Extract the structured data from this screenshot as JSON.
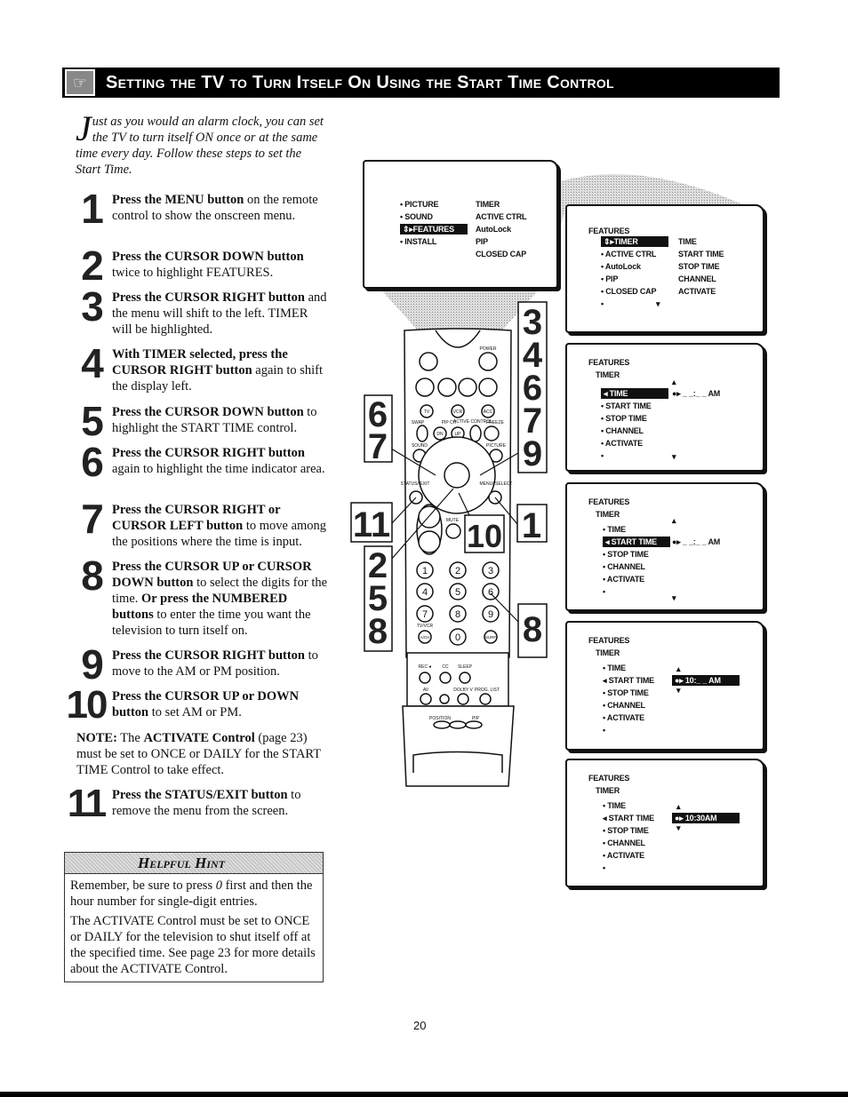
{
  "header": {
    "title": "Setting the TV to Turn Itself On Using the Start Time Control",
    "icon": "remote-hand-icon"
  },
  "intro": {
    "dropcap": "J",
    "text": "ust as you would an alarm clock, you can set the TV to turn itself ON once or at the same time every day. Follow these steps to set the Start Time."
  },
  "steps": [
    {
      "num": "1",
      "parts": [
        {
          "b": true,
          "t": "Press the MENU button"
        },
        {
          "b": false,
          "t": " on the remote control to show the onscreen menu."
        }
      ]
    },
    {
      "num": "2",
      "parts": [
        {
          "b": true,
          "t": "Press the CURSOR DOWN button"
        },
        {
          "b": false,
          "t": " twice to highlight FEATURES."
        }
      ]
    },
    {
      "num": "3",
      "parts": [
        {
          "b": true,
          "t": "Press the CURSOR RIGHT button"
        },
        {
          "b": false,
          "t": " and the menu will shift to the left. TIMER will be highlighted."
        }
      ]
    },
    {
      "num": "4",
      "parts": [
        {
          "b": true,
          "t": "With TIMER selected, press the CURSOR RIGHT button"
        },
        {
          "b": false,
          "t": " again to shift the display left."
        }
      ]
    },
    {
      "num": "5",
      "parts": [
        {
          "b": true,
          "t": "Press the CURSOR DOWN button"
        },
        {
          "b": false,
          "t": " to highlight the START TIME control."
        }
      ]
    },
    {
      "num": "6",
      "parts": [
        {
          "b": true,
          "t": "Press the CURSOR RIGHT button"
        },
        {
          "b": false,
          "t": " again to highlight the time indicator area."
        }
      ]
    },
    {
      "num": "7",
      "parts": [
        {
          "b": true,
          "t": "Press the CURSOR RIGHT or CURSOR LEFT button"
        },
        {
          "b": false,
          "t": " to move among the positions where the time is input."
        }
      ]
    },
    {
      "num": "8",
      "parts": [
        {
          "b": true,
          "t": "Press the CURSOR UP or CURSOR DOWN button"
        },
        {
          "b": false,
          "t": " to select the digits for the time. "
        },
        {
          "b": true,
          "t": "Or press the NUMBERED buttons"
        },
        {
          "b": false,
          "t": " to enter the time you want the television to turn itself on."
        }
      ]
    },
    {
      "num": "9",
      "parts": [
        {
          "b": true,
          "t": "Press the CURSOR RIGHT button"
        },
        {
          "b": false,
          "t": " to move to the AM or PM  position."
        }
      ]
    },
    {
      "num": "10",
      "parts": [
        {
          "b": true,
          "t": "Press the CURSOR UP or DOWN button"
        },
        {
          "b": false,
          "t": " to set AM or PM."
        }
      ]
    },
    {
      "num": "11",
      "parts": [
        {
          "b": true,
          "t": "Press the STATUS/EXIT button"
        },
        {
          "b": false,
          "t": " to remove the menu from the screen."
        }
      ]
    }
  ],
  "note": {
    "parts": [
      {
        "b": true,
        "t": "NOTE:"
      },
      {
        "b": false,
        "t": " The "
      },
      {
        "b": true,
        "t": "ACTIVATE Control"
      },
      {
        "b": false,
        "t": " (page 23) must be set to ONCE or DAILY for the START TIME Control to take effect."
      }
    ]
  },
  "hint": {
    "title": "Helpful Hint",
    "p1_a": "Remember, be sure to press ",
    "p1_zero": "0",
    "p1_b": " first and then the hour number for single-digit entries.",
    "p2": "The ACTIVATE Control must be set to ONCE or DAILY for the television to shut itself off at the specified time. See page 23 for more details about the ACTIVATE Control."
  },
  "page_number": "20",
  "screens": [
    {
      "rows": [
        {
          "t": "• PICTURE",
          "c": 0,
          "r": 0
        },
        {
          "t": "• SOUND",
          "c": 0,
          "r": 1
        },
        {
          "t": "⇕▸FEATURES",
          "c": 0,
          "r": 2,
          "hl": true
        },
        {
          "t": "• INSTALL",
          "c": 0,
          "r": 3
        },
        {
          "t": "TIMER",
          "c": 1,
          "r": 0
        },
        {
          "t": "ACTIVE CTRL",
          "c": 1,
          "r": 1
        },
        {
          "t": "AutoLock",
          "c": 1,
          "r": 2
        },
        {
          "t": "PIP",
          "c": 1,
          "r": 3
        },
        {
          "t": "CLOSED CAP",
          "c": 1,
          "r": 4
        }
      ]
    },
    {
      "rows": [
        {
          "t": "FEATURES",
          "c": -1,
          "r": 0
        },
        {
          "t": "⇕▸TIMER",
          "c": 0,
          "r": 2,
          "hl": true
        },
        {
          "t": "• ACTIVE CTRL",
          "c": 0,
          "r": 3
        },
        {
          "t": "• AutoLock",
          "c": 0,
          "r": 4
        },
        {
          "t": "• PIP",
          "c": 0,
          "r": 5
        },
        {
          "t": "• CLOSED CAP",
          "c": 0,
          "r": 6
        },
        {
          "t": "•",
          "c": 0,
          "r": 7
        },
        {
          "t": "▾",
          "c": 2,
          "r": 7
        },
        {
          "t": "TIME",
          "c": 1,
          "r": 2
        },
        {
          "t": "START TIME",
          "c": 1,
          "r": 3
        },
        {
          "t": "STOP TIME",
          "c": 1,
          "r": 4
        },
        {
          "t": "CHANNEL",
          "c": 1,
          "r": 5
        },
        {
          "t": "ACTIVATE",
          "c": 1,
          "r": 6
        }
      ]
    },
    {
      "rows": [
        {
          "t": "FEATURES",
          "c": -1,
          "r": 0
        },
        {
          "t": "TIMER",
          "c": -2,
          "r": 1
        },
        {
          "t": "◂ TIME",
          "c": 0,
          "r": 2.5,
          "hl": true
        },
        {
          "t": "• START TIME",
          "c": 0,
          "r": 3.5
        },
        {
          "t": "• STOP TIME",
          "c": 0,
          "r": 4.5
        },
        {
          "t": "• CHANNEL",
          "c": 0,
          "r": 5.5
        },
        {
          "t": "• ACTIVATE",
          "c": 0,
          "r": 6.5
        },
        {
          "t": "•",
          "c": 0,
          "r": 7.5
        },
        {
          "t": "▴",
          "c": 1,
          "r": 1.6
        },
        {
          "t": "●▸  _ _:_ _  AM",
          "c": 1,
          "r": 2.5
        },
        {
          "t": "▾",
          "c": 1,
          "r": 7.6
        }
      ]
    },
    {
      "rows": [
        {
          "t": "FEATURES",
          "c": -1,
          "r": 0
        },
        {
          "t": "TIMER",
          "c": -2,
          "r": 1
        },
        {
          "t": "• TIME",
          "c": 0,
          "r": 2.2
        },
        {
          "t": "◂ START TIME",
          "c": 0,
          "r": 3.2,
          "hl": true
        },
        {
          "t": "• STOP TIME",
          "c": 0,
          "r": 4.2
        },
        {
          "t": "• CHANNEL",
          "c": 0,
          "r": 5.2
        },
        {
          "t": "• ACTIVATE",
          "c": 0,
          "r": 6.2
        },
        {
          "t": "•",
          "c": 0,
          "r": 7.2
        },
        {
          "t": "▴",
          "c": 1,
          "r": 1.5
        },
        {
          "t": "●▸  _ _:_ _  AM",
          "c": 1,
          "r": 3.2
        },
        {
          "t": "▾",
          "c": 1,
          "r": 7.7
        }
      ]
    },
    {
      "rows": [
        {
          "t": "FEATURES",
          "c": -1,
          "r": 0
        },
        {
          "t": "TIMER",
          "c": -2,
          "r": 1
        },
        {
          "t": "• TIME",
          "c": 0,
          "r": 2.2
        },
        {
          "t": "◂ START TIME",
          "c": 0,
          "r": 3.2
        },
        {
          "t": "• STOP TIME",
          "c": 0,
          "r": 4.2
        },
        {
          "t": "• CHANNEL",
          "c": 0,
          "r": 5.2
        },
        {
          "t": "• ACTIVATE",
          "c": 0,
          "r": 6.2
        },
        {
          "t": "•",
          "c": 0,
          "r": 7.2
        },
        {
          "t": "▴",
          "c": 3,
          "r": 2.3
        },
        {
          "t": "●▸  10:_ _  AM",
          "c": 1,
          "r": 3.2,
          "hl": true
        },
        {
          "t": "▾",
          "c": 3,
          "r": 4.0
        }
      ]
    },
    {
      "rows": [
        {
          "t": "FEATURES",
          "c": -1,
          "r": 0
        },
        {
          "t": "TIMER",
          "c": -2,
          "r": 1
        },
        {
          "t": "• TIME",
          "c": 0,
          "r": 2.2
        },
        {
          "t": "◂ START TIME",
          "c": 0,
          "r": 3.2
        },
        {
          "t": "• STOP TIME",
          "c": 0,
          "r": 4.2
        },
        {
          "t": "• CHANNEL",
          "c": 0,
          "r": 5.2
        },
        {
          "t": "• ACTIVATE",
          "c": 0,
          "r": 6.2
        },
        {
          "t": "•",
          "c": 0,
          "r": 7.2
        },
        {
          "t": "▴",
          "c": 3,
          "r": 2.3
        },
        {
          "t": "●▸  10:30AM   ",
          "c": 1,
          "r": 3.2,
          "hl": true
        },
        {
          "t": "▾",
          "c": 3,
          "r": 4.0
        }
      ]
    }
  ],
  "remote": {
    "power": "POWER",
    "swap": "SWAP",
    "pip_ch": "PIP CH",
    "active_control": "ACTIVE CONTROL",
    "freeze": "FREEZE",
    "tv": "TV",
    "vcr": "VCR",
    "acc": "ACC",
    "dn": "DN",
    "up": "UP",
    "sound": "SOUND",
    "picture": "PICTURE",
    "status_exit": "STATUS/ EXIT",
    "menu_select": "MENU/ SELECT",
    "mute": "MUTE",
    "digits": [
      "1",
      "2",
      "3",
      "4",
      "5",
      "6",
      "7",
      "8",
      "9",
      "0"
    ],
    "tv_vcr": "TV/VCR",
    "ach": "A/CH",
    "surf": "SURF",
    "rec": "REC ●",
    "cc": "CC",
    "sleep": "SLEEP",
    "av": "AV",
    "dolby": "DOLBY V",
    "prog_list": "PROG. LIST",
    "position": "POSITION",
    "pip": "PIP"
  },
  "callouts": {
    "right_top": [
      "3",
      "4",
      "6",
      "7",
      "9"
    ],
    "left_top": [
      "6",
      "7"
    ],
    "status": "11",
    "cursor": "10",
    "menu": "1",
    "left_mid": [
      "2",
      "5",
      "8"
    ],
    "digit": "8"
  }
}
